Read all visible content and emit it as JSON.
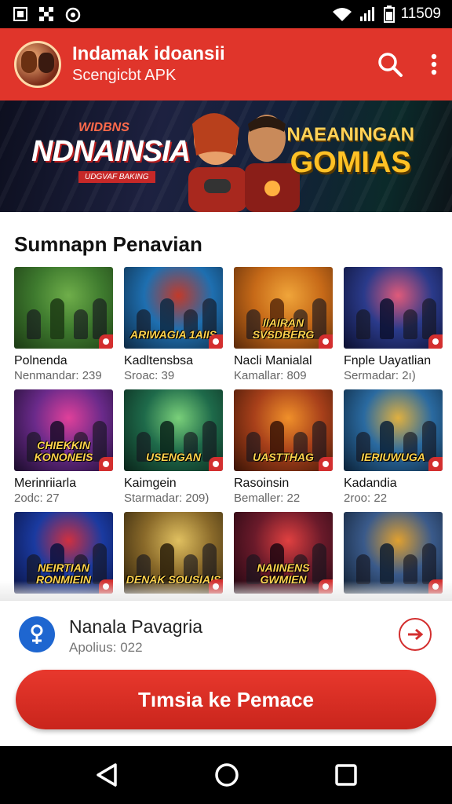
{
  "status": {
    "time": "11509"
  },
  "app": {
    "title": "Indamak idoansii",
    "subtitle": "Scengicbt APK"
  },
  "banner": {
    "tag": "WIDBNS",
    "word": "NDNAINSIA",
    "small": "UDGVAF BAKING",
    "right_line1": "NAEANINGAN",
    "right_line2": "GOMIAS"
  },
  "section": {
    "title": "Sumnapn Penavian"
  },
  "games": [
    {
      "title": "Polnenda",
      "meta": "Nenmandar: 239",
      "caption": "",
      "colors": [
        "#3e7a2e",
        "#6fae4a",
        "#1c3a14"
      ]
    },
    {
      "title": "Kadltensbsa",
      "meta": "Sroac: 39",
      "caption": "ARIWAGIA 1AIIS",
      "colors": [
        "#1e6fb0",
        "#c23a2a",
        "#0e2a44"
      ]
    },
    {
      "title": "Nacli Manialal",
      "meta": "Kamallar: 809",
      "caption": "IIAIRAN SVSDBERG",
      "colors": [
        "#c76a18",
        "#f0a53a",
        "#5a2a0a"
      ]
    },
    {
      "title": "Fnple Uayatlian",
      "meta": "Sermadar: 2ı)",
      "caption": "",
      "colors": [
        "#2a3a8a",
        "#e05a7a",
        "#0c1030"
      ]
    },
    {
      "title": "Merinriiarla",
      "meta": "2odc: 27",
      "caption": "CHIEKKIN KONONEIS",
      "colors": [
        "#6a2a8a",
        "#e0409a",
        "#1a0c2a"
      ]
    },
    {
      "title": "Kaimgein",
      "meta": "Starmadar: 209)",
      "caption": "USENGAN",
      "colors": [
        "#1e6a4a",
        "#7ad07a",
        "#0a241a"
      ]
    },
    {
      "title": "Rasoinsin",
      "meta": "Bemaller: 22",
      "caption": "UASTTHAG",
      "colors": [
        "#a8401a",
        "#f0902a",
        "#3a1406"
      ]
    },
    {
      "title": "Kadandia",
      "meta": "2roo: 22",
      "caption": "IERIUWUGA",
      "colors": [
        "#2a6aa0",
        "#e0b040",
        "#0c2238"
      ]
    },
    {
      "title": "",
      "meta": "",
      "caption": "NEIRTIAN RONMIEIN",
      "colors": [
        "#1a3aa0",
        "#d03040",
        "#0a1240"
      ]
    },
    {
      "title": "",
      "meta": "",
      "caption": "DENAK SOUSIAIS",
      "colors": [
        "#8a6a2a",
        "#e0c060",
        "#2a1e0a"
      ]
    },
    {
      "title": "",
      "meta": "",
      "caption": "NAIINENS GWMIEN",
      "colors": [
        "#6a1a2a",
        "#e04040",
        "#1e0610"
      ]
    },
    {
      "title": "",
      "meta": "",
      "caption": "",
      "colors": [
        "#3a5a8a",
        "#e0a030",
        "#101e30"
      ]
    }
  ],
  "now": {
    "title": "Nanala Pavagria",
    "sub": "Apolius: 022"
  },
  "cta": {
    "label": "Tımsia ke Pemace"
  },
  "icons": {
    "status": [
      "gallery-icon",
      "settings-dots-icon",
      "alarm-icon",
      "wifi-icon",
      "signal-icon",
      "battery-icon"
    ],
    "appbar": [
      "search-icon",
      "more-vert-icon"
    ],
    "nav": [
      "back-icon",
      "home-icon",
      "recents-icon"
    ]
  }
}
